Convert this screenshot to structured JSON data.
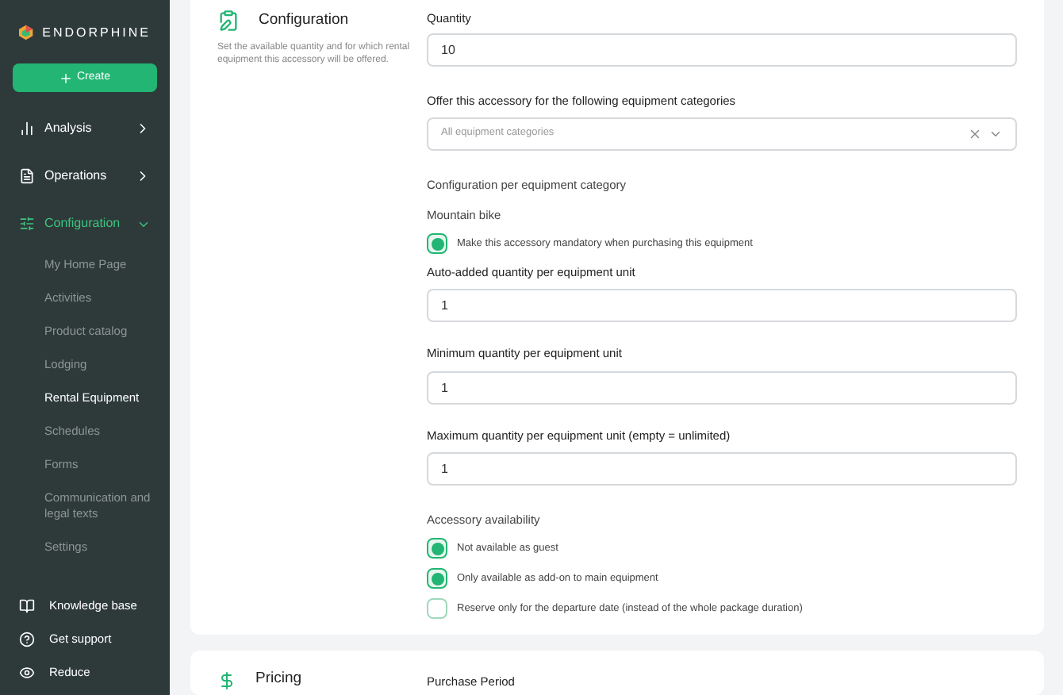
{
  "sidebar": {
    "brand": "ENDORPHINE",
    "create_button": "Create",
    "items": [
      {
        "label": "Analysis",
        "expanded": false,
        "selected": false
      },
      {
        "label": "Operations",
        "expanded": false,
        "selected": false
      },
      {
        "label": "Configuration",
        "expanded": true,
        "selected": true,
        "children": [
          {
            "label": "My Home Page",
            "selected": false
          },
          {
            "label": "Activities",
            "selected": false
          },
          {
            "label": "Product catalog",
            "selected": false
          },
          {
            "label": "Lodging",
            "selected": false
          },
          {
            "label": "Rental Equipment",
            "selected": true
          },
          {
            "label": "Schedules",
            "selected": false
          },
          {
            "label": "Forms",
            "selected": false
          },
          {
            "label": "Communication and legal texts",
            "selected": false
          },
          {
            "label": "Settings",
            "selected": false
          }
        ]
      }
    ],
    "footer": [
      {
        "label": "Knowledge base"
      },
      {
        "label": "Get support"
      },
      {
        "label": "Reduce"
      }
    ]
  },
  "configuration_card": {
    "title": "Configuration",
    "description": "Set the available quantity and for which rental equipment this accessory will be offered.",
    "quantity": {
      "label": "Quantity",
      "value": "10"
    },
    "categories": {
      "label": "Offer this accessory for the following equipment categories",
      "placeholder": "All equipment categories"
    },
    "per_category_heading": "Configuration per equipment category",
    "category_name": "Mountain bike",
    "mandatory": {
      "label": "Make this accessory mandatory when purchasing this equipment",
      "checked": true
    },
    "fields": [
      {
        "label": "Auto-added quantity per equipment unit",
        "value": "1"
      },
      {
        "label": "Minimum quantity per equipment unit",
        "value": "1"
      },
      {
        "label": "Maximum quantity per equipment unit (empty = unlimited)",
        "value": "1"
      }
    ],
    "availability_heading": "Accessory availability",
    "availability": [
      {
        "label": "Not available as guest",
        "checked": true
      },
      {
        "label": "Only available as add-on to main equipment",
        "checked": true
      },
      {
        "label": "Reserve only for the departure date (instead of the whole package duration)",
        "checked": false
      }
    ]
  },
  "pricing_card": {
    "title": "Pricing",
    "field_label": "Purchase Period"
  }
}
